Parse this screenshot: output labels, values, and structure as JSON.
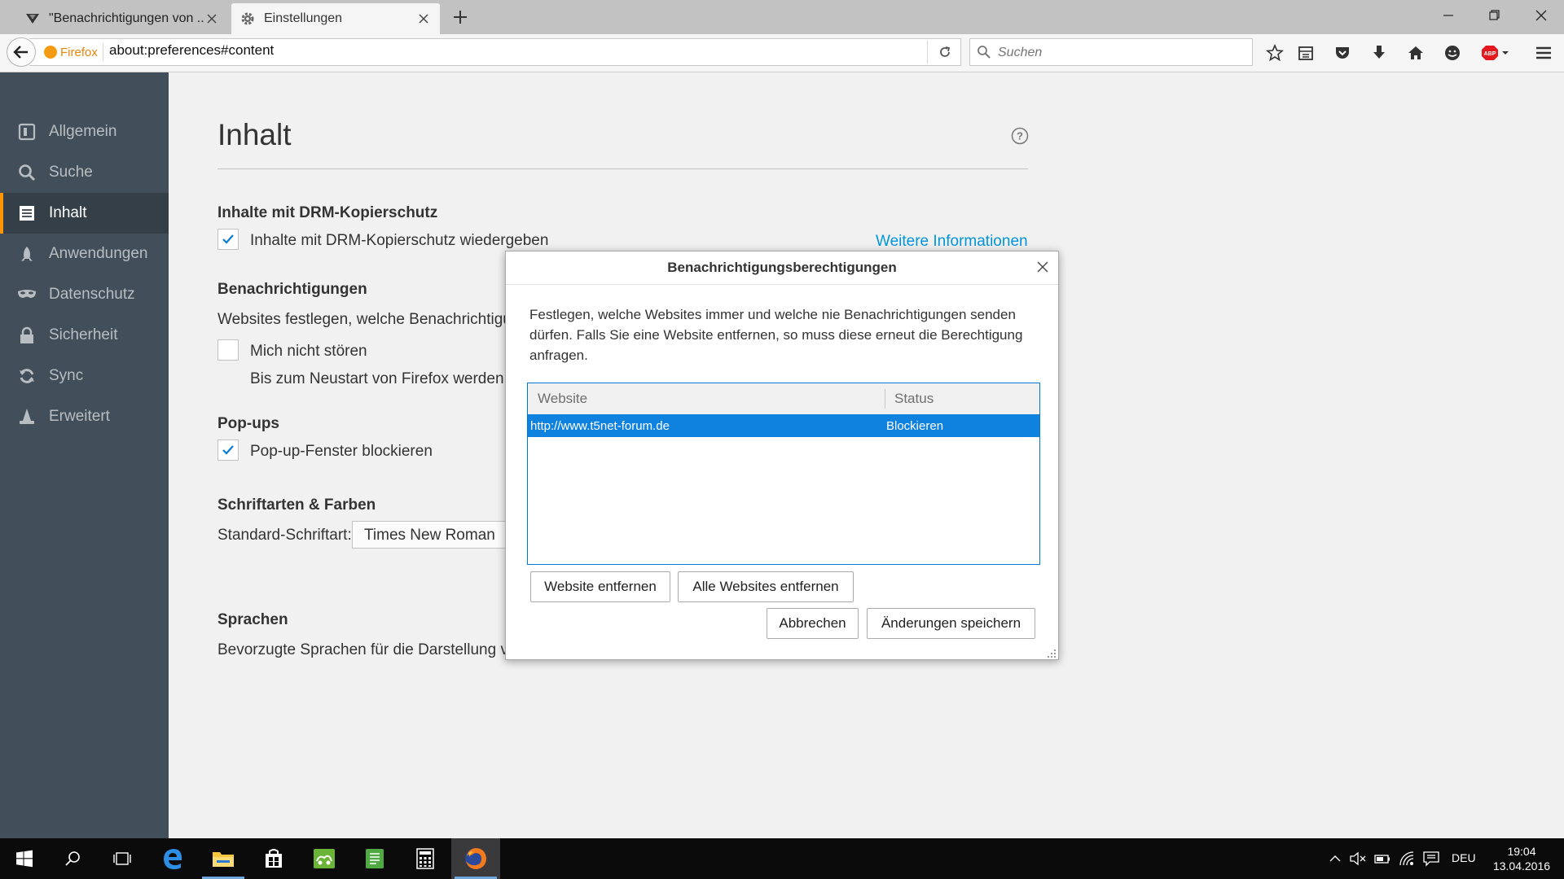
{
  "tabs": [
    {
      "title": "\"Benachrichtigungen von ...",
      "active": false,
      "icon": "t5net-favicon-icon"
    },
    {
      "title": "Einstellungen",
      "active": true,
      "icon": "gear-icon"
    }
  ],
  "urlbar": {
    "identity": "Firefox",
    "url": "about:preferences#content"
  },
  "searchbar": {
    "placeholder": "Suchen"
  },
  "sidebar": {
    "items": [
      {
        "label": "Allgemein",
        "icon": "general-icon",
        "selected": false
      },
      {
        "label": "Suche",
        "icon": "search-icon",
        "selected": false
      },
      {
        "label": "Inhalt",
        "icon": "content-icon",
        "selected": true
      },
      {
        "label": "Anwendungen",
        "icon": "applications-icon",
        "selected": false
      },
      {
        "label": "Datenschutz",
        "icon": "mask-icon",
        "selected": false
      },
      {
        "label": "Sicherheit",
        "icon": "lock-icon",
        "selected": false
      },
      {
        "label": "Sync",
        "icon": "sync-icon",
        "selected": false
      },
      {
        "label": "Erweitert",
        "icon": "wizard-hat-icon",
        "selected": false
      }
    ]
  },
  "page": {
    "title": "Inhalt",
    "drm": {
      "heading": "Inhalte mit DRM-Kopierschutz",
      "checkbox_label": "Inhalte mit DRM-Kopierschutz wiedergeben",
      "checked": true,
      "link": "Weitere Informationen"
    },
    "notifications": {
      "heading": "Benachrichtigungen",
      "description": "Websites festlegen, welche Benachrichtigun",
      "dnd_label": "Mich nicht stören",
      "dnd_checked": false,
      "dnd_note": "Bis zum Neustart von Firefox werden k"
    },
    "popups": {
      "heading": "Pop-ups",
      "checkbox_label": "Pop-up-Fenster blockieren",
      "checked": true
    },
    "fonts": {
      "heading": "Schriftarten & Farben",
      "label": "Standard-Schriftart:",
      "value": "Times New Roman"
    },
    "languages": {
      "heading": "Sprachen",
      "description": "Bevorzugte Sprachen für die Darstellung vo"
    }
  },
  "dialog": {
    "title": "Benachrichtigungsberechtigungen",
    "intro": "Festlegen, welche Websites immer und welche nie Benachrichtigungen senden dürfen. Falls Sie eine Website entfernen, so muss diese erneut die Berechtigung anfragen.",
    "columns": {
      "website": "Website",
      "status": "Status"
    },
    "rows": [
      {
        "site": "http://www.t5net-forum.de",
        "status": "Blockieren"
      }
    ],
    "buttons": {
      "remove": "Website entfernen",
      "remove_all": "Alle Websites entfernen",
      "cancel": "Abbrechen",
      "save": "Änderungen speichern"
    }
  },
  "taskbar": {
    "apps": [
      "start-icon",
      "search-icon",
      "task-view-icon",
      "edge-icon",
      "file-explorer-icon",
      "store-icon",
      "app-icon",
      "notes-icon",
      "calculator-icon",
      "firefox-icon"
    ],
    "lang": "DEU",
    "time": "19:04",
    "date": "13.04.2016"
  },
  "colors": {
    "accent": "#0095dd",
    "sidebar": "#424f5a",
    "selected_row": "#0f82e0",
    "category_marker": "#ff9500"
  }
}
